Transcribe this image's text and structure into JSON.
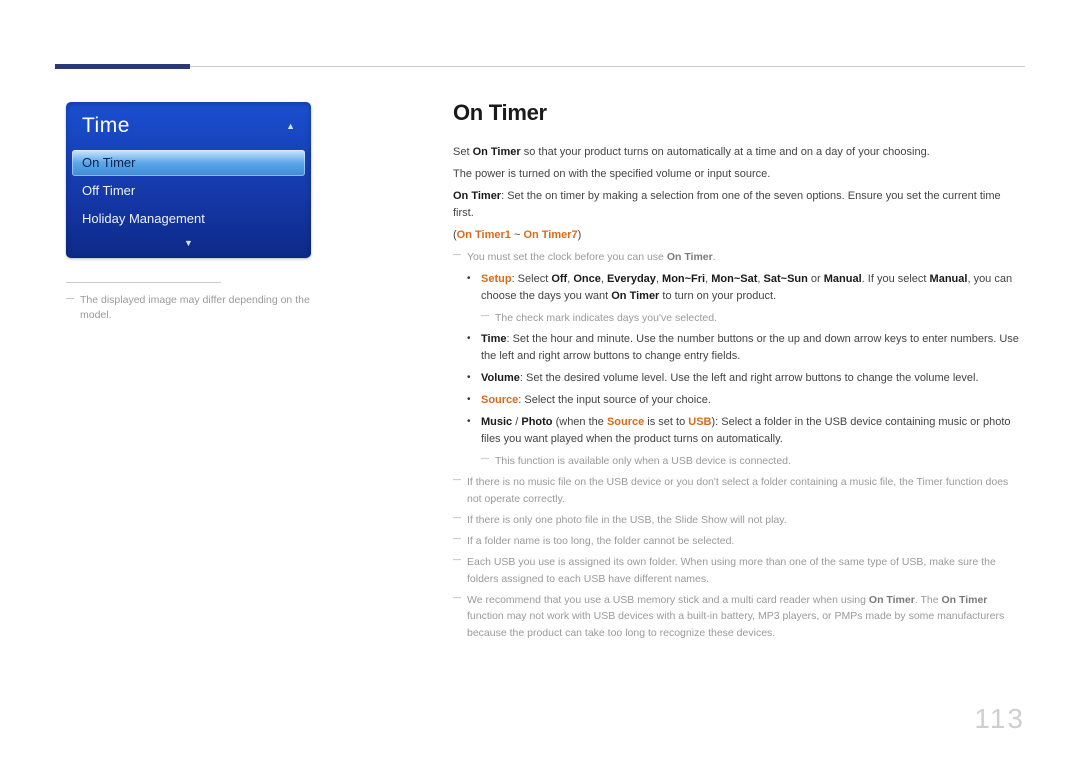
{
  "page_number": "113",
  "sidebar": {
    "panel_title": "Time",
    "items": [
      {
        "label": "On Timer",
        "selected": true
      },
      {
        "label": "Off Timer",
        "selected": false
      },
      {
        "label": "Holiday Management",
        "selected": false
      }
    ],
    "note_text": "The displayed image may differ depending on the model."
  },
  "content": {
    "title": "On Timer",
    "p1_pre": "Set ",
    "p1_bold": "On Timer",
    "p1_post": " so that your product turns on automatically at a time and on a day of your choosing.",
    "p2": "The power is turned on with the specified volume or input source.",
    "p3_bold": "On Timer",
    "p3_post": ": Set the on timer by making a selection from one of the seven options. Ensure you set the current time first.",
    "range_pre": "(",
    "range_a": "On Timer1",
    "range_mid": " ~ ",
    "range_b": "On Timer7",
    "range_post": ")",
    "mustset_pre": "You must set the clock before you can use ",
    "mustset_bold": "On Timer",
    "mustset_post": ".",
    "setup": {
      "label": "Setup",
      "pre": ": Select ",
      "opt_off": "Off",
      "c1": ", ",
      "opt_once": "Once",
      "c2": ", ",
      "opt_every": "Everyday",
      "c3": ", ",
      "opt_mf": "Mon~Fri",
      "c4": ", ",
      "opt_ms": "Mon~Sat",
      "c5": ", ",
      "opt_ss": "Sat~Sun",
      "c6": " or ",
      "opt_manual": "Manual",
      "post1": ". If you select ",
      "manual2": "Manual",
      "post2": ", you can choose the days you want ",
      "b_on": "On Timer",
      "post3": " to turn on your product."
    },
    "checkmark_note": "The check mark indicates days you've selected.",
    "time": {
      "label": "Time",
      "text": ": Set the hour and minute. Use the number buttons or the up and down arrow keys to enter numbers. Use the left and right arrow buttons to change entry fields."
    },
    "volume": {
      "label": "Volume",
      "text": ": Set the desired volume level. Use the left and right arrow buttons to change the volume level."
    },
    "source": {
      "label": "Source",
      "text": ": Select the input source of your choice."
    },
    "music": {
      "label_a": "Music",
      "slash": " / ",
      "label_b": "Photo",
      "pre": " (when the ",
      "src_bold": "Source",
      "mid": " is set to ",
      "usb_bold": "USB",
      "text": "): Select a folder in the USB device containing music or photo files you want played when the product turns on automatically."
    },
    "usb_only_note": "This function is available only when a USB device is connected.",
    "notes": [
      "If there is no music file on the USB device or you don't select a folder containing a music file, the Timer function does not operate correctly.",
      "If there is only one photo file in the USB, the Slide Show will not play.",
      "If a folder name is too long, the folder cannot be selected.",
      "Each USB you use is assigned its own folder. When using more than one of the same type of USB, make sure the folders assigned to each USB have different names."
    ],
    "rec_pre": "We recommend that you use a USB memory stick and a multi card reader when using ",
    "rec_b1": "On Timer",
    "rec_mid": ". The ",
    "rec_b2": "On Timer",
    "rec_post": " function may not work with USB devices with a built-in battery, MP3 players, or PMPs made by some manufacturers because the product can take too long to recognize these devices."
  }
}
